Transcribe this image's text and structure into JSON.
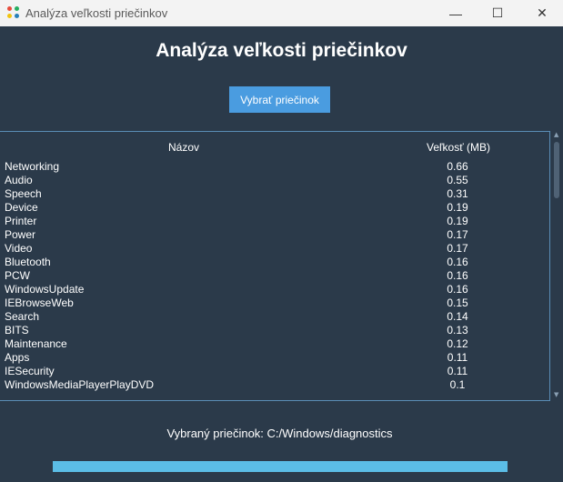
{
  "window": {
    "title": "Analýza veľkosti priečinkov",
    "minimize_glyph": "—",
    "maximize_glyph": "☐",
    "close_glyph": "✕"
  },
  "heading": "Analýza veľkosti priečinkov",
  "select_button": "Vybrať priečinok",
  "table": {
    "columns": {
      "name": "Názov",
      "size": "Veľkosť (MB)"
    },
    "rows": [
      {
        "name": "Networking",
        "size": "0.66"
      },
      {
        "name": "Audio",
        "size": "0.55"
      },
      {
        "name": "Speech",
        "size": "0.31"
      },
      {
        "name": "Device",
        "size": "0.19"
      },
      {
        "name": "Printer",
        "size": "0.19"
      },
      {
        "name": "Power",
        "size": "0.17"
      },
      {
        "name": "Video",
        "size": "0.17"
      },
      {
        "name": "Bluetooth",
        "size": "0.16"
      },
      {
        "name": "PCW",
        "size": "0.16"
      },
      {
        "name": "WindowsUpdate",
        "size": "0.16"
      },
      {
        "name": "IEBrowseWeb",
        "size": "0.15"
      },
      {
        "name": "Search",
        "size": "0.14"
      },
      {
        "name": "BITS",
        "size": "0.13"
      },
      {
        "name": "Maintenance",
        "size": "0.12"
      },
      {
        "name": "Apps",
        "size": "0.11"
      },
      {
        "name": "IESecurity",
        "size": "0.11"
      },
      {
        "name": "WindowsMediaPlayerPlayDVD",
        "size": "0.1"
      }
    ]
  },
  "status": "Vybraný priečinok: C:/Windows/diagnostics",
  "progress": 1.0,
  "colors": {
    "background": "#2b3a4a",
    "button": "#4a9ce0",
    "progress": "#5bbde6",
    "table_border": "#5a8db5"
  }
}
